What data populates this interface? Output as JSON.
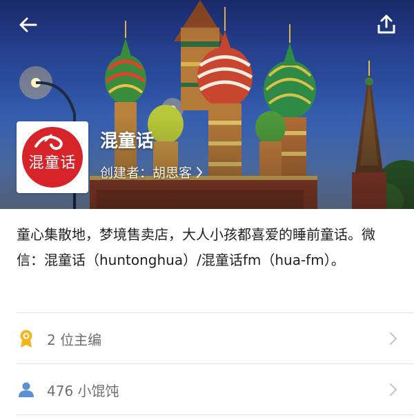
{
  "header": {
    "back_icon": "arrow-left-icon",
    "share_icon": "share-upload-icon",
    "title": "混童话",
    "creator": "创建者：胡思客",
    "avatar_text": "混童话"
  },
  "description": "童心集散地，梦境售卖店，大人小孩都喜爱的睡前童话。微信：混童话（huntonghua）/混童话fm（hua-fm）。",
  "rows": [
    {
      "label": "2 位主编",
      "icon": "award-badge-icon",
      "icon_color": "#f2b51c"
    },
    {
      "label": "476 小馄饨",
      "icon": "user-icon",
      "icon_color": "#5b8fd6"
    }
  ],
  "colors": {
    "text_primary": "#1f1f1f",
    "text_secondary": "#6e6e6e",
    "avatar_red": "#d7232a",
    "divider": "#e2e2e2"
  }
}
